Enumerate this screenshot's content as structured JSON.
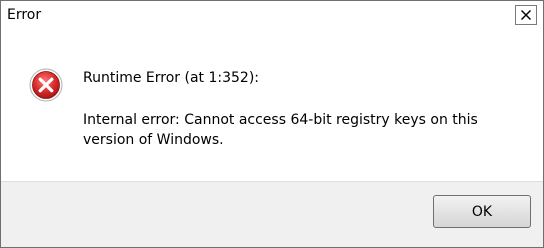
{
  "window": {
    "title": "Error",
    "close_icon": "close-icon"
  },
  "dialog": {
    "icon": "error-icon",
    "heading": "Runtime Error (at 1:352):",
    "message": "Internal error: Cannot access 64-bit registry keys on this version of Windows."
  },
  "buttons": {
    "ok_label": "OK"
  },
  "colors": {
    "footer_bg": "#f0f0f0",
    "error_red": "#cc2222"
  }
}
